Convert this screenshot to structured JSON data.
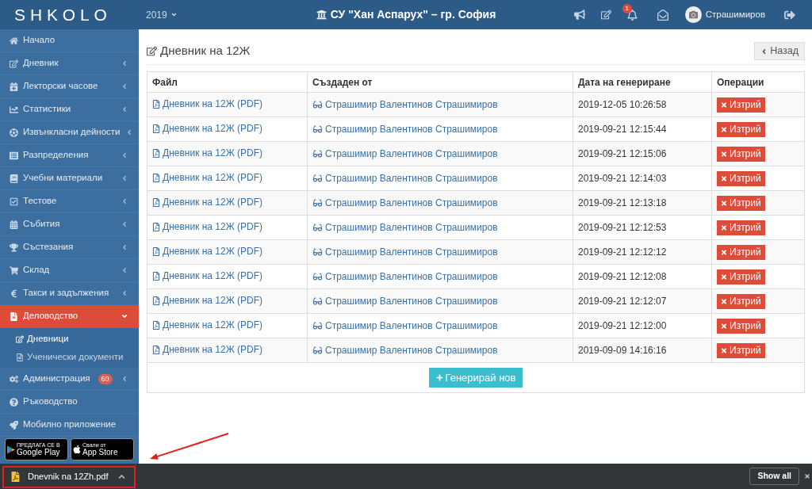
{
  "header": {
    "logo": "SHKOLO",
    "year": "2019",
    "school": "СУ \"Хан Аспарух\" – гр. София",
    "notifications": "1",
    "user": "Страшимиров"
  },
  "sidebar": {
    "items": [
      {
        "label": "Начало",
        "kind": "link",
        "expanded": false,
        "selected": false
      },
      {
        "label": "Дневник",
        "kind": "group",
        "expanded": false,
        "selected": false
      },
      {
        "label": "Лекторски часове",
        "kind": "group",
        "expanded": false,
        "selected": false
      },
      {
        "label": "Статистики",
        "kind": "group",
        "expanded": false,
        "selected": false
      },
      {
        "label": "Извънкласни дейности",
        "kind": "group",
        "expanded": false,
        "selected": false
      },
      {
        "label": "Разпределения",
        "kind": "group",
        "expanded": false,
        "selected": false
      },
      {
        "label": "Учебни материали",
        "kind": "group",
        "expanded": false,
        "selected": false
      },
      {
        "label": "Тестове",
        "kind": "group",
        "expanded": false,
        "selected": false
      },
      {
        "label": "Събития",
        "kind": "group",
        "expanded": false,
        "selected": false
      },
      {
        "label": "Състезания",
        "kind": "group",
        "expanded": false,
        "selected": false
      },
      {
        "label": "Склад",
        "kind": "group",
        "expanded": false,
        "selected": false
      },
      {
        "label": "Такси и задължения",
        "kind": "group",
        "expanded": false,
        "selected": false
      },
      {
        "label": "Деловодство",
        "kind": "group",
        "expanded": true,
        "selected": true,
        "children": [
          {
            "label": "Дневници",
            "selected": true
          },
          {
            "label": "Ученически документи",
            "selected": false
          }
        ]
      },
      {
        "label": "Администрация",
        "kind": "group",
        "expanded": false,
        "selected": false,
        "badge": "60"
      },
      {
        "label": "Ръководство",
        "kind": "link",
        "expanded": false,
        "selected": false
      },
      {
        "label": "Мобилно приложение",
        "kind": "link",
        "expanded": false,
        "selected": false
      }
    ],
    "app_badges": [
      {
        "caption": "ПРЕДЛАГА СЕ В",
        "store": "Google Play"
      },
      {
        "caption": "Свали от",
        "store": "App Store"
      }
    ]
  },
  "page": {
    "title": "Дневник на 12Ж",
    "back_button": "Назад"
  },
  "table": {
    "columns": [
      "Файл",
      "Създаден от",
      "Дата на генериране",
      "Операции"
    ],
    "rows": [
      {
        "file": "Дневник на 12Ж (PDF)",
        "created_by": "Страшимир Валентинов Страшимиров",
        "generated_at": "2019-12-05 10:26:58",
        "operation": "Изтрий"
      },
      {
        "file": "Дневник на 12Ж (PDF)",
        "created_by": "Страшимир Валентинов Страшимиров",
        "generated_at": "2019-09-21 12:15:44",
        "operation": "Изтрий"
      },
      {
        "file": "Дневник на 12Ж (PDF)",
        "created_by": "Страшимир Валентинов Страшимиров",
        "generated_at": "2019-09-21 12:15:06",
        "operation": "Изтрий"
      },
      {
        "file": "Дневник на 12Ж (PDF)",
        "created_by": "Страшимир Валентинов Страшимиров",
        "generated_at": "2019-09-21 12:14:03",
        "operation": "Изтрий"
      },
      {
        "file": "Дневник на 12Ж (PDF)",
        "created_by": "Страшимир Валентинов Страшимиров",
        "generated_at": "2019-09-21 12:13:18",
        "operation": "Изтрий"
      },
      {
        "file": "Дневник на 12Ж (PDF)",
        "created_by": "Страшимир Валентинов Страшимиров",
        "generated_at": "2019-09-21 12:12:53",
        "operation": "Изтрий"
      },
      {
        "file": "Дневник на 12Ж (PDF)",
        "created_by": "Страшимир Валентинов Страшимиров",
        "generated_at": "2019-09-21 12:12:12",
        "operation": "Изтрий"
      },
      {
        "file": "Дневник на 12Ж (PDF)",
        "created_by": "Страшимир Валентинов Страшимиров",
        "generated_at": "2019-09-21 12:12:08",
        "operation": "Изтрий"
      },
      {
        "file": "Дневник на 12Ж (PDF)",
        "created_by": "Страшимир Валентинов Страшимиров",
        "generated_at": "2019-09-21 12:12:07",
        "operation": "Изтрий"
      },
      {
        "file": "Дневник на 12Ж (PDF)",
        "created_by": "Страшимир Валентинов Страшимиров",
        "generated_at": "2019-09-21 12:12:00",
        "operation": "Изтрий"
      },
      {
        "file": "Дневник на 12Ж (PDF)",
        "created_by": "Страшимир Валентинов Страшимиров",
        "generated_at": "2019-09-09 14:16:16",
        "operation": "Изтрий"
      }
    ],
    "generate_button": "Генерирай нов"
  },
  "download_bar": {
    "file": "Dnevnik na 12Zh.pdf",
    "show_all": "Show all"
  }
}
